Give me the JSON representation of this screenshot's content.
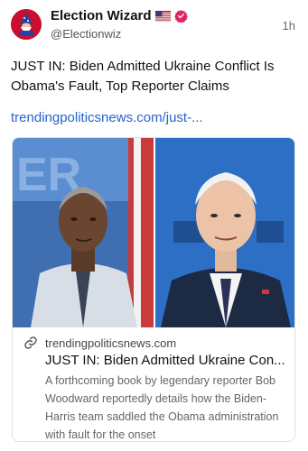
{
  "post": {
    "author": {
      "display_name": "Election Wizard",
      "handle": "@Electionwiz",
      "flag_icon": "us-flag-icon",
      "verified_icon": "verified-badge-icon",
      "verified_color": "#e0245e"
    },
    "timestamp": "1h",
    "text": "JUST IN: Biden Admitted Ukraine Conflict Is Obama's Fault, Top Reporter Claims",
    "link_text": "trendingpoliticsnews.com/just-...",
    "link_color": "#2563c9"
  },
  "card": {
    "domain": "trendingpoliticsnews.com",
    "title": "JUST IN: Biden Admitted Ukraine Con...",
    "description": "A forthcoming book by legendary reporter Bob Woodward reportedly details how the Biden-Harris team saddled the Obama administration with fault for the onset",
    "link_icon": "link-icon"
  }
}
